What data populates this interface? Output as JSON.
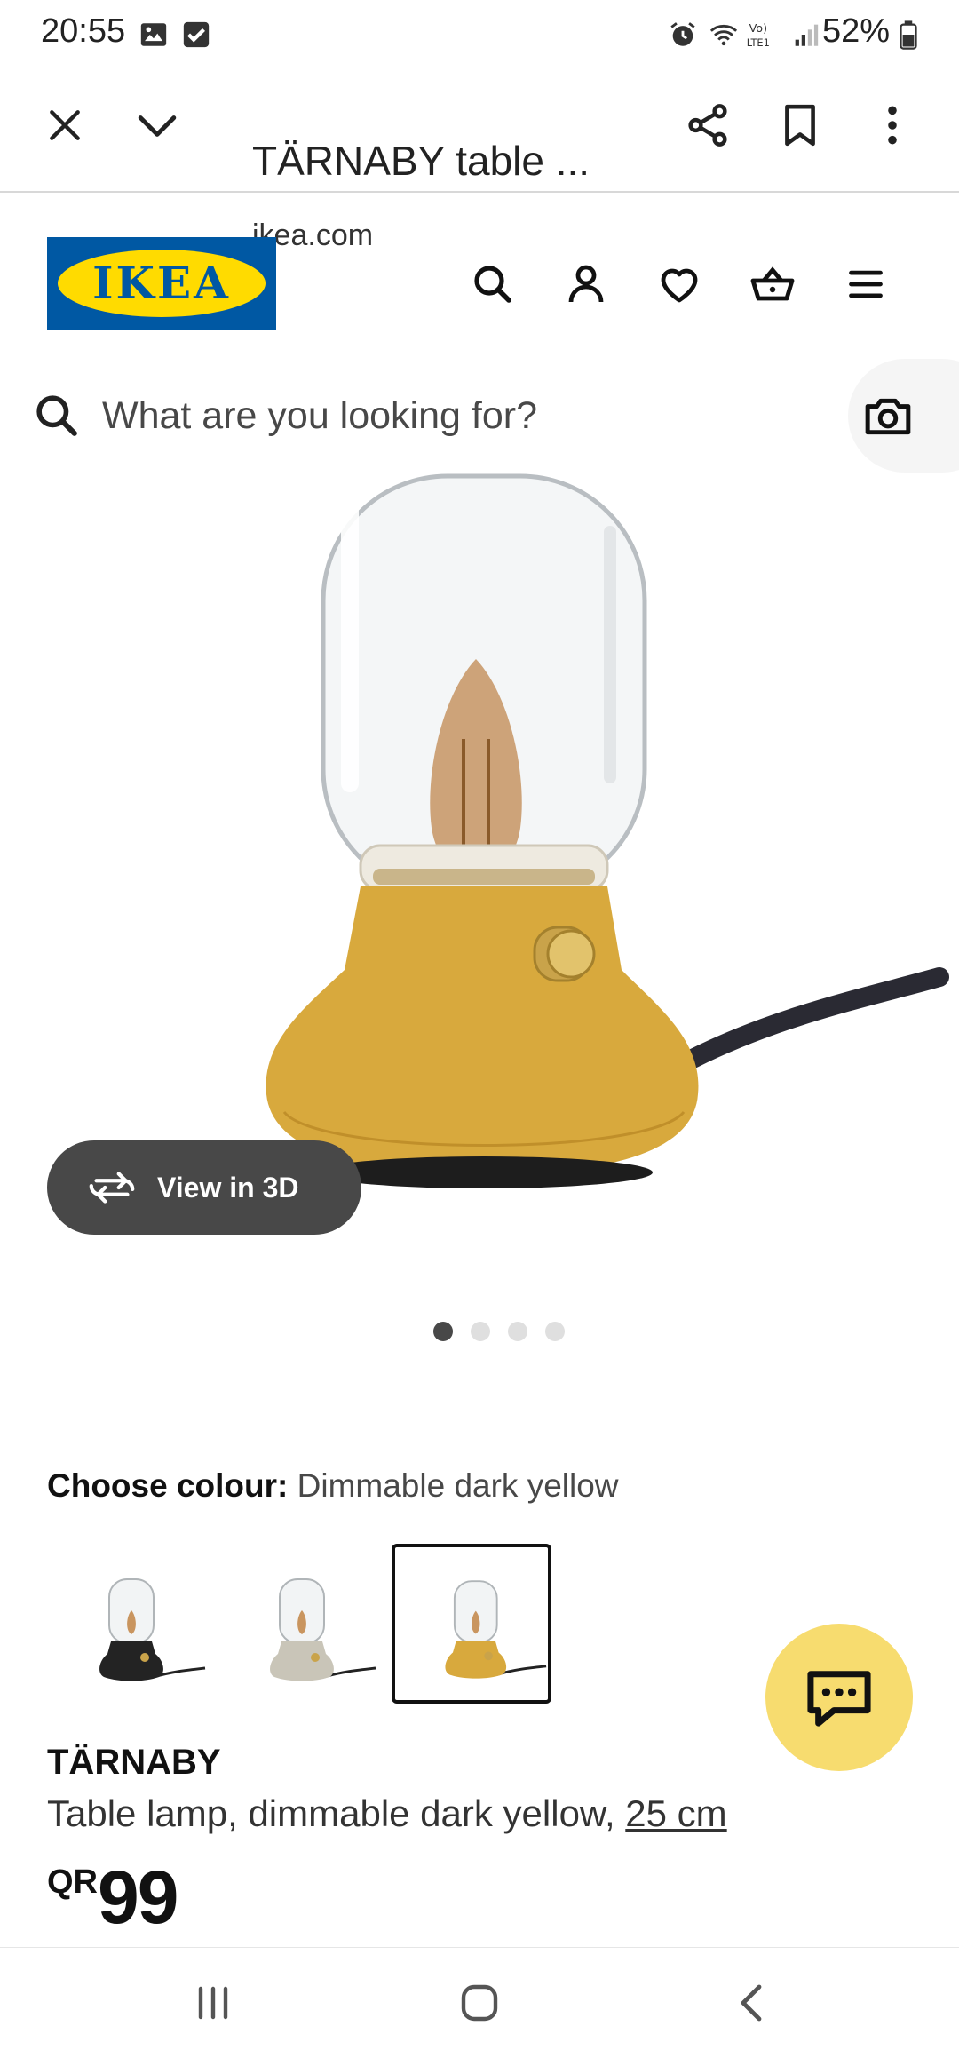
{
  "status_bar": {
    "time": "20:55",
    "battery": "52%",
    "icons": [
      "image-icon",
      "check-box-icon",
      "alarm-icon",
      "wifi-icon",
      "volte-icon",
      "signal-icon",
      "battery-icon"
    ]
  },
  "browser": {
    "title": "TÄRNABY table ...",
    "url": "ikea.com",
    "icons": [
      "close-icon",
      "chevron-down-icon",
      "share-icon",
      "bookmark-icon",
      "more-vertical-icon"
    ]
  },
  "header": {
    "logo_text": "IKEA",
    "icons": [
      "search-icon",
      "account-icon",
      "heart-icon",
      "basket-icon",
      "menu-icon"
    ]
  },
  "search": {
    "placeholder": "What are you looking for?",
    "camera_icon": "camera-icon"
  },
  "gallery": {
    "view_3d_label": "View in 3D",
    "dot_count": 4,
    "active_dot": 0
  },
  "colour": {
    "label": "Choose colour:",
    "value": "Dimmable dark yellow",
    "swatches": [
      {
        "name": "black",
        "color": "#1f1f1f",
        "selected": false
      },
      {
        "name": "grey-beige",
        "color": "#c9c5b8",
        "selected": false
      },
      {
        "name": "dark-yellow",
        "color": "#d8a93d",
        "selected": true
      }
    ]
  },
  "product": {
    "name": "TÄRNABY",
    "description": "Table lamp, dimmable dark yellow, ",
    "size_link": "25 cm",
    "price_currency": "QR",
    "price_value": "99"
  },
  "colors": {
    "ikea_blue": "#0058a3",
    "ikea_yellow": "#ffdb00",
    "lamp_yellow": "#d8a93d",
    "chat_yellow": "#f7dc6f",
    "dark_grey": "#484848"
  }
}
